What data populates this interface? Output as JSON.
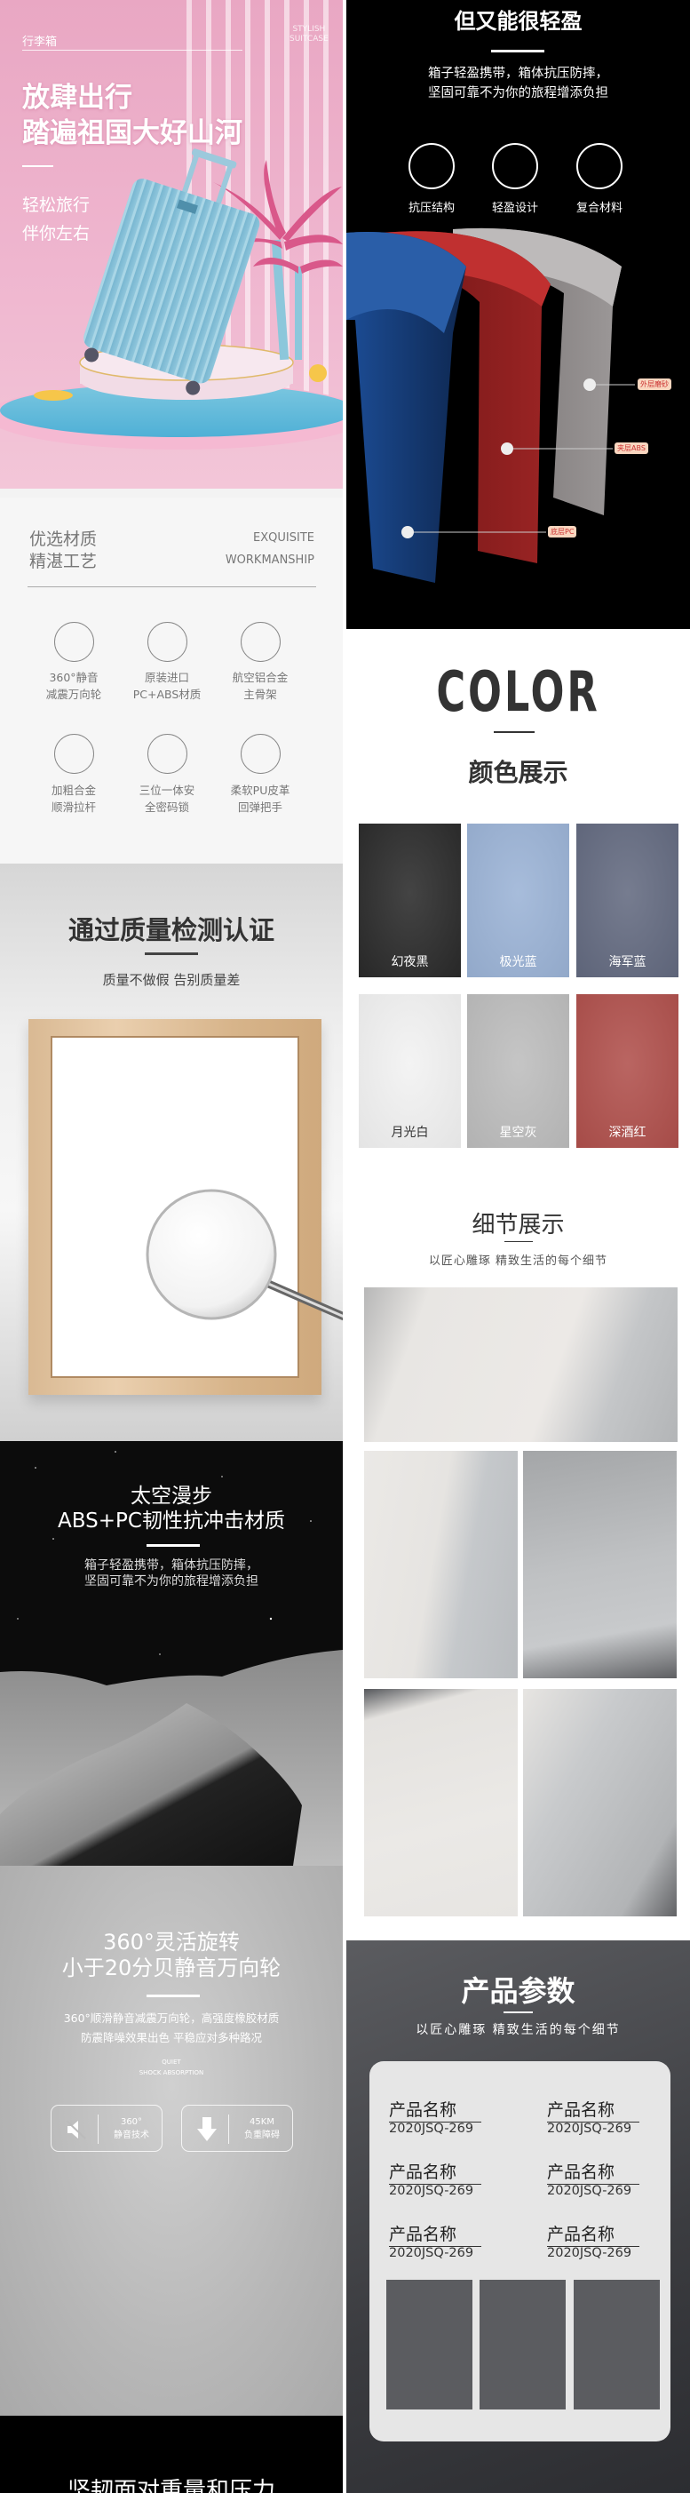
{
  "hero": {
    "tag": "行李箱",
    "english": [
      "STYLISH",
      "SUITCASE"
    ],
    "title": [
      "放肆出行",
      "踏遍祖国大好山河"
    ],
    "subtitle": [
      "轻松旅行",
      "伴你左右"
    ],
    "accent": "#efb6cf"
  },
  "craft": {
    "title": [
      "优选材质",
      "精湛工艺"
    ],
    "english": [
      "EXQUISITE",
      "WORKMANSHIP"
    ],
    "features": [
      {
        "lines": [
          "360°静音",
          "减震万向轮"
        ]
      },
      {
        "lines": [
          "原装进口",
          "PC+ABS材质"
        ]
      },
      {
        "lines": [
          "航空铝合金",
          "主骨架"
        ]
      },
      {
        "lines": [
          "加粗合金",
          "顺滑拉杆"
        ]
      },
      {
        "lines": [
          "三位一体安",
          "全密码锁"
        ]
      },
      {
        "lines": [
          "柔软PU皮革",
          "回弹把手"
        ]
      }
    ]
  },
  "quality": {
    "title": "通过质量检测认证",
    "subtitle": "质量不做假 告别质量差"
  },
  "space": {
    "title": [
      "太空漫步",
      "ABS+PC韧性抗冲击材质"
    ],
    "desc": [
      "箱子轻盈携带，箱体抗压防摔，",
      "坚固可靠不为你的旅程增添负担"
    ]
  },
  "wheel": {
    "title": [
      "360°灵活旋转",
      "小于20分贝静音万向轮"
    ],
    "desc": [
      "360°顺滑静音减震万向轮，高强度橡胶材质",
      "防震降噪效果出色 平稳应对多种路况"
    ],
    "english": [
      "QUIET",
      "SHOCK ABSORPTION"
    ],
    "badges": [
      {
        "icon": "mute-speaker",
        "lines": [
          "360°",
          "静音技术"
        ]
      },
      {
        "icon": "arrow-down",
        "lines": [
          "45KM",
          "负重障碍"
        ]
      }
    ]
  },
  "strength": {
    "title": "坚韧面对重量和压力"
  },
  "light": {
    "title": "但又能很轻盈",
    "desc": [
      "箱子轻盈携带，箱体抗压防摔，",
      "坚固可靠不为你的旅程增添负担"
    ],
    "features": [
      "抗压结构",
      "轻盈设计",
      "复合材料"
    ],
    "layers": [
      "外层磨砂",
      "夹层ABS",
      "底层PC"
    ]
  },
  "colors": {
    "heading": "COLOR",
    "title": "颜色展示",
    "swatches": [
      {
        "name": "幻夜黑",
        "color": "#2a2a2a"
      },
      {
        "name": "极光蓝",
        "color": "#9bb3d6"
      },
      {
        "name": "海军蓝",
        "color": "#636a80"
      },
      {
        "name": "月光白",
        "color": "#f2f2f2"
      },
      {
        "name": "星空灰",
        "color": "#bdbdbd"
      },
      {
        "name": "深酒红",
        "color": "#b0504c"
      }
    ]
  },
  "details": {
    "title": "细节展示",
    "subtitle": "以匠心雕琢 精致生活的每个细节"
  },
  "params": {
    "title": "产品参数",
    "subtitle": "以匠心雕琢 精致生活的每个细节",
    "items": [
      {
        "label": "产品名称",
        "value": "2020JSQ-269"
      },
      {
        "label": "产品名称",
        "value": "2020JSQ-269"
      },
      {
        "label": "产品名称",
        "value": "2020JSQ-269"
      },
      {
        "label": "产品名称",
        "value": "2020JSQ-269"
      },
      {
        "label": "产品名称",
        "value": "2020JSQ-269"
      },
      {
        "label": "产品名称",
        "value": "2020JSQ-269"
      }
    ]
  }
}
